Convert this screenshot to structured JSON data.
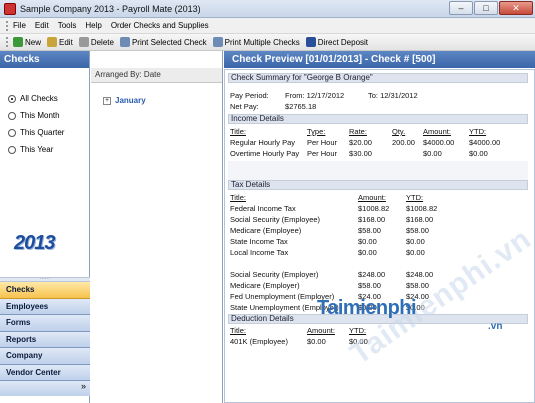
{
  "window": {
    "title": "Sample Company 2013 - Payroll Mate (2013)",
    "minimize": "–",
    "maximize": "□",
    "close": "✕"
  },
  "menu": [
    "File",
    "Edit",
    "Tools",
    "Help",
    "Order Checks and Supplies"
  ],
  "toolbar": [
    {
      "label": "New",
      "icon": "new-icon",
      "color": "#3a9a3a"
    },
    {
      "label": "Edit",
      "icon": "edit-icon",
      "color": "#c9a43a"
    },
    {
      "label": "Delete",
      "icon": "delete-icon",
      "color": "#999999"
    },
    {
      "label": "Print Selected Check",
      "icon": "print-icon",
      "color": "#6d8bb5"
    },
    {
      "label": "Print Multiple Checks",
      "icon": "print-multiple-icon",
      "color": "#6d8bb5"
    },
    {
      "label": "Direct Deposit",
      "icon": "direct-deposit-icon",
      "color": "#2a4f9a"
    }
  ],
  "left": {
    "header": "Checks",
    "filters": [
      "All Checks",
      "This Month",
      "This Quarter",
      "This Year"
    ],
    "selected_filter": 0,
    "year_logo": "2013",
    "nav": [
      "Checks",
      "Employees",
      "Forms",
      "Reports",
      "Company",
      "Vendor Center"
    ],
    "active_nav": 0,
    "nav_more": "»"
  },
  "middle": {
    "header": "Arranged By: Date",
    "groups": [
      {
        "label": "January"
      }
    ]
  },
  "preview": {
    "header": "Check Preview [01/01/2013] - Check # [500]",
    "summary": "Check Summary for \"George B Orange\"",
    "pay_period_label": "Pay Period:",
    "from": "From: 12/17/2012",
    "to": "To: 12/31/2012",
    "net_pay_label": "Net Pay:",
    "net_pay": "$2765.18",
    "income": {
      "title": "Income Details",
      "headers": [
        "Title:",
        "Type:",
        "Rate:",
        "Qty.",
        "Amount:",
        "YTD:"
      ],
      "rows": [
        [
          "Regular Hourly Pay",
          "Per Hour",
          "$20.00",
          "200.00",
          "$4000.00",
          "$4000.00"
        ],
        [
          "Overtime Hourly Pay",
          "Per Hour",
          "$30.00",
          "",
          "$0.00",
          "$0.00"
        ]
      ]
    },
    "tax": {
      "title": "Tax Details",
      "headers": [
        "Title:",
        "Amount:",
        "YTD:"
      ],
      "employee_rows": [
        [
          "Federal Income Tax",
          "$1008.82",
          "$1008.82"
        ],
        [
          "Social Security (Employee)",
          "$168.00",
          "$168.00"
        ],
        [
          "Medicare (Employee)",
          "$58.00",
          "$58.00"
        ],
        [
          "State Income Tax",
          "$0.00",
          "$0.00"
        ],
        [
          "Local Income Tax",
          "$0.00",
          "$0.00"
        ]
      ],
      "employer_rows": [
        [
          "Social Security (Employer)",
          "$248.00",
          "$248.00"
        ],
        [
          "Medicare (Employer)",
          "$58.00",
          "$58.00"
        ],
        [
          "Fed Unemployment (Employer)",
          "$24.00",
          "$24.00"
        ],
        [
          "State Unemployment (Employer)",
          "$0.00",
          "$0.00"
        ]
      ]
    },
    "deduction": {
      "title": "Deduction Details",
      "headers": [
        "Title:",
        "Amount:",
        "YTD:"
      ],
      "rows": [
        [
          "401K (Employee)",
          "$0.00",
          "$0.00"
        ]
      ]
    }
  },
  "watermark": {
    "brand": "Taimienphi",
    "domain": ".vn",
    "diagonal": "Taimienphi.vn"
  }
}
